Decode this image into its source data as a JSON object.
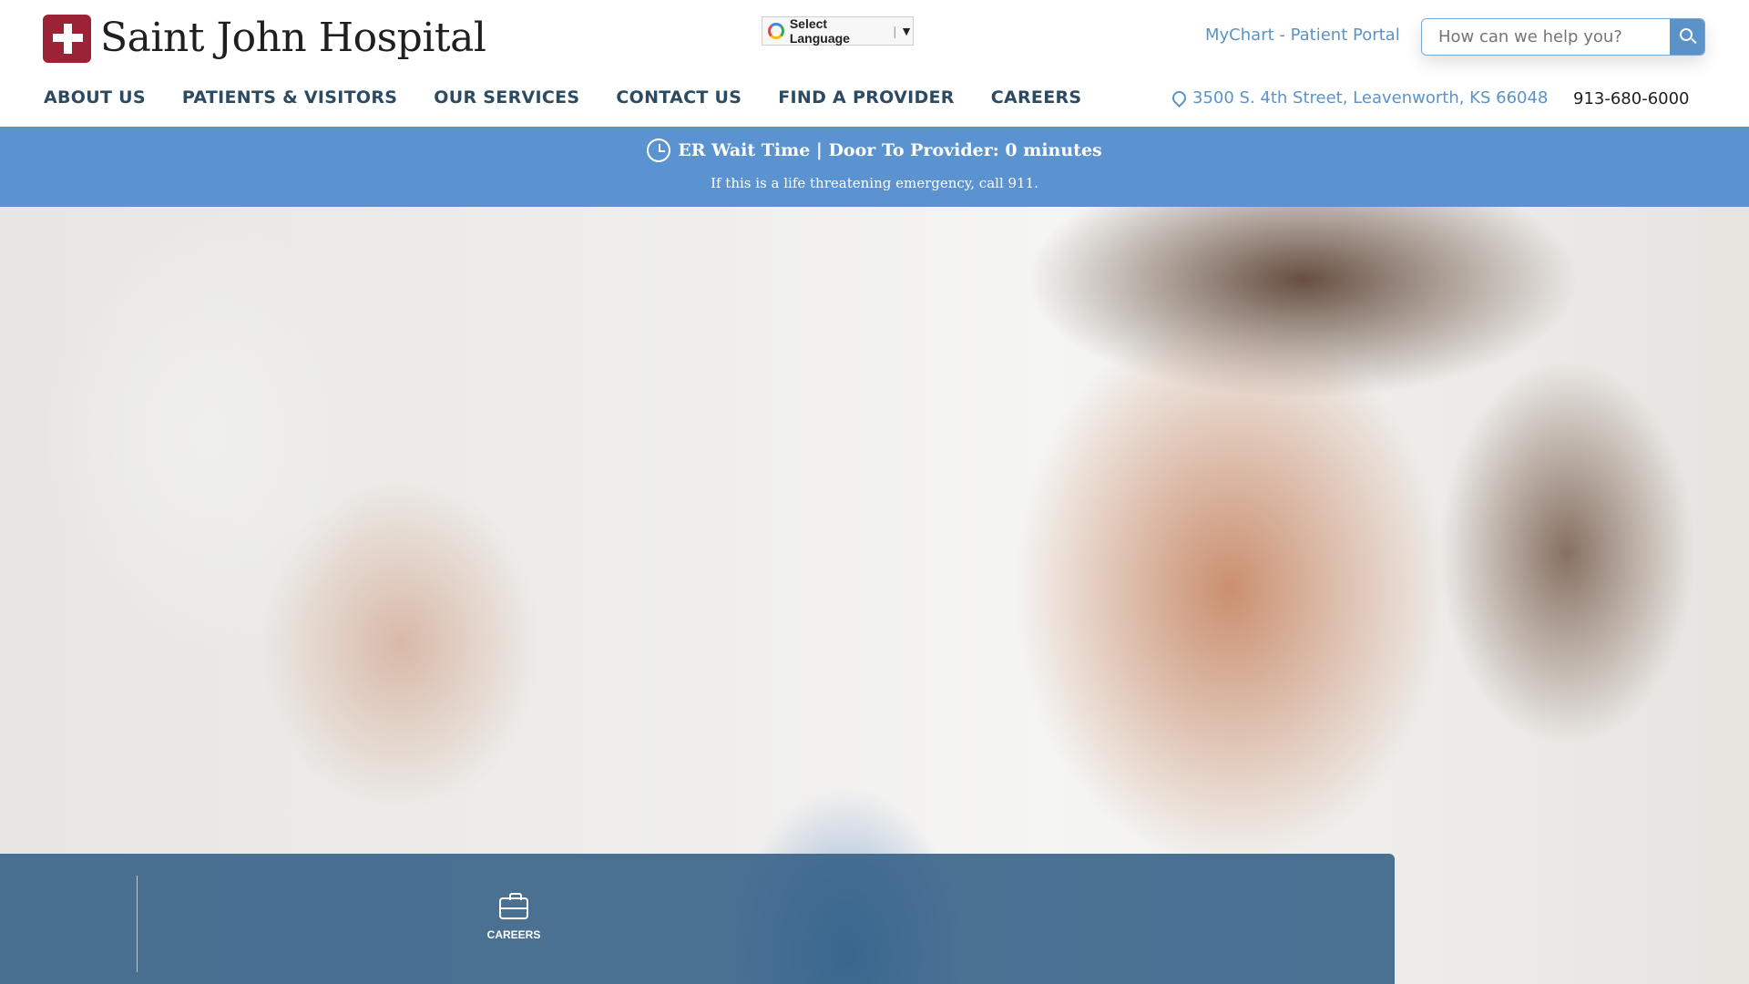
{
  "brand": {
    "name": "Saint John Hospital"
  },
  "language": {
    "label": "Select Language",
    "arrow": "▼"
  },
  "header": {
    "portal_link": "MyChart - Patient Portal",
    "search_placeholder": "How can we help you?"
  },
  "nav": {
    "items": [
      {
        "label": "ABOUT US"
      },
      {
        "label": "PATIENTS & VISITORS"
      },
      {
        "label": "OUR SERVICES"
      },
      {
        "label": "CONTACT US"
      },
      {
        "label": "FIND A PROVIDER"
      },
      {
        "label": "CAREERS"
      }
    ],
    "address": "3500 S. 4th Street, Leavenworth, KS 66048",
    "phone": "913-680-6000"
  },
  "er_banner": {
    "title": "ER Wait Time | Door To Provider: 0 minutes",
    "subtitle": "If this is a life threatening emergency, call 911."
  },
  "quick_links": {
    "careers": {
      "label": "CAREERS",
      "icon": "briefcase-icon"
    }
  },
  "colors": {
    "accent": "#5b93c9",
    "banner": "#5b93d0",
    "brand_red": "#9b2335",
    "nav_text": "#2d4a63"
  }
}
